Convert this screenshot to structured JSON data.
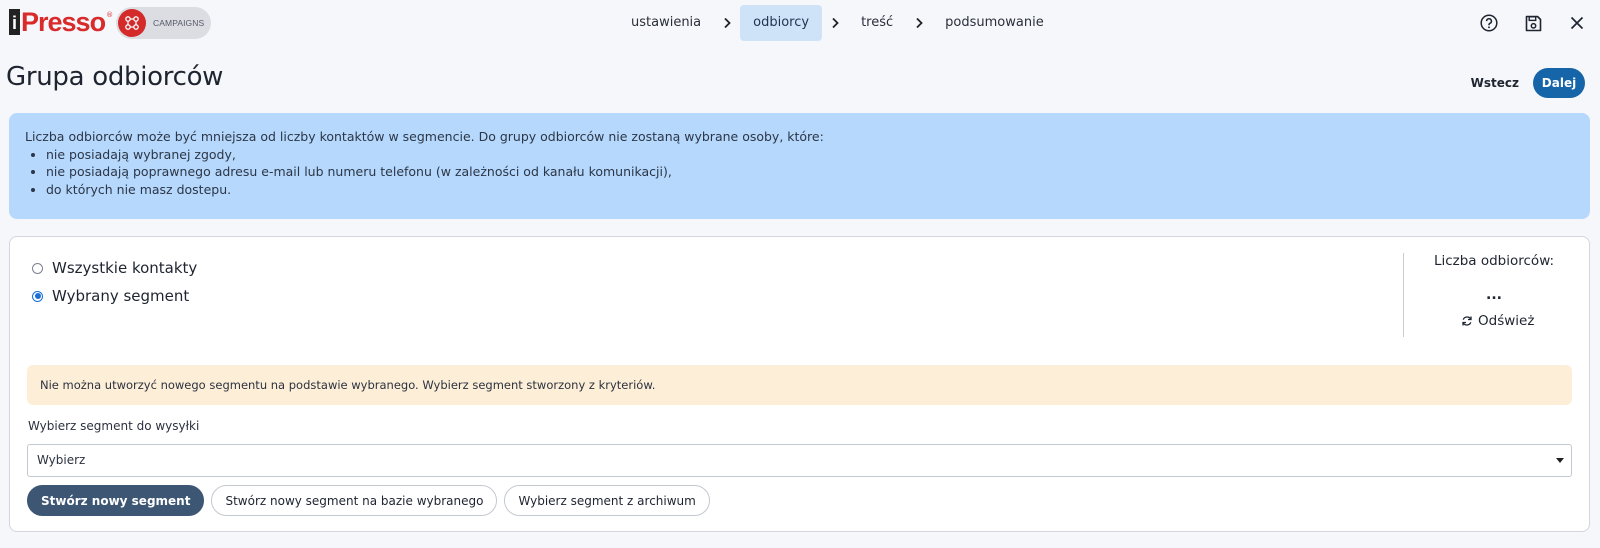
{
  "brand": {
    "logo_text": "Presso",
    "logo_letter": "i",
    "logo_reg": "®",
    "module_label": "CAMPAIGNS",
    "brand_color": "#d92b2b"
  },
  "steps": [
    {
      "label": "ustawienia",
      "active": false
    },
    {
      "label": "odbiorcy",
      "active": true
    },
    {
      "label": "treść",
      "active": false
    },
    {
      "label": "podsumowanie",
      "active": false
    }
  ],
  "top_icons": [
    "help-circle-icon",
    "save-icon",
    "close-icon"
  ],
  "page": {
    "title": "Grupa odbiorców",
    "back_label": "Wstecz",
    "next_label": "Dalej"
  },
  "info": {
    "intro": "Liczba odbiorców może być mniejsza od liczby kontaktów w segmencie. Do grupy odbiorców nie zostaną wybrane osoby, które:",
    "items": [
      "nie posiadają wybranej zgody,",
      "nie posiadają poprawnego adresu e-mail lub numeru telefonu (w zależności od kanału komunikacji),",
      "do których nie masz dostepu."
    ]
  },
  "audience": {
    "options": [
      {
        "label": "Wszystkie kontakty",
        "checked": false
      },
      {
        "label": "Wybrany segment",
        "checked": true
      }
    ],
    "count_label": "Liczba odbiorców:",
    "count_value": "...",
    "refresh_label": "Odśwież"
  },
  "warning": "Nie można utworzyć nowego segmentu na podstawie wybranego. Wybierz segment stworzony z kryteriów.",
  "segment_select": {
    "label": "Wybierz segment do wysyłki",
    "value": "Wybierz"
  },
  "actions": {
    "create_new": "Stwórz nowy segment",
    "create_from_selected": "Stwórz nowy segment na bazie wybranego",
    "choose_from_archive": "Wybierz segment z archiwum"
  },
  "colors": {
    "accent": "#1565a8",
    "active_step_bg": "#cfe3f8",
    "info_bg": "#b5d8fc",
    "warning_bg": "#fdefd7",
    "primary_button": "#3d5674"
  }
}
